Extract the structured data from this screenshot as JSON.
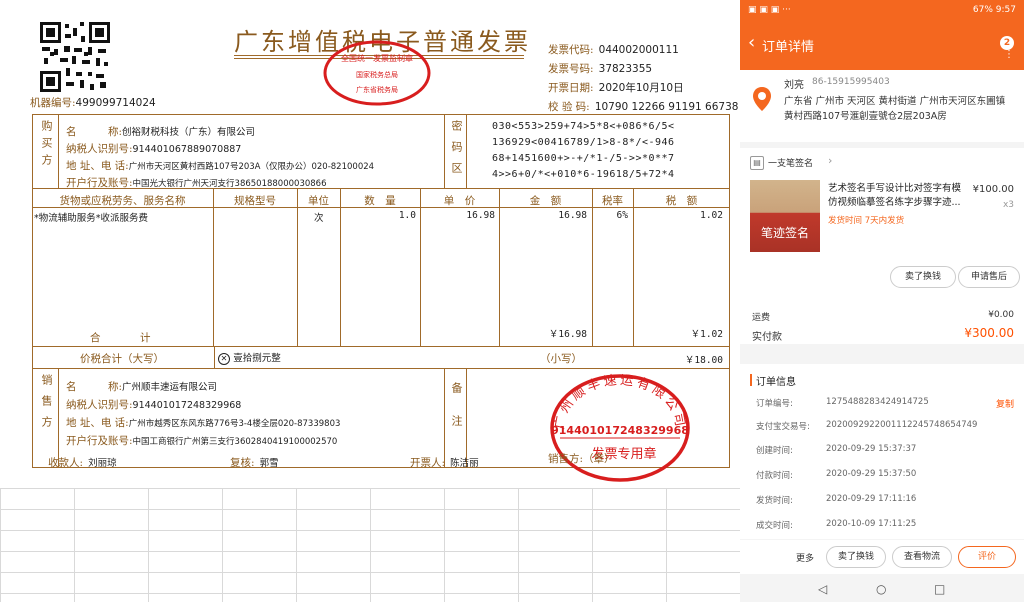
{
  "invoice": {
    "title": "广东增值税电子普通发票",
    "machine_label": "机器编号:",
    "machine_no": "499099714024",
    "header": {
      "code_label": "发票代码:",
      "code": "044002000111",
      "number_label": "发票号码:",
      "number": "37823355",
      "date_label": "开票日期:",
      "date": "2020年10月10日",
      "check_label": "校 验 码:",
      "check": "10790 12266 91191 66738"
    },
    "tax_seal": {
      "line1": "全国统一发票监制章",
      "line2": "国家税务总局",
      "line3": "广东省税务局"
    },
    "buyer": {
      "side_label": "购买方",
      "name_label": "名　　　称:",
      "name": "创裕财税科技（广东）有限公司",
      "taxid_label": "纳税人识别号:",
      "taxid": "914401067889070887",
      "addr_label": "地 址、电 话:",
      "addr": "广州市天河区黄村西路107号203A（仅限办公）020-82100024",
      "bank_label": "开户行及账号:",
      "bank": "中国光大银行广州天河支行38650188000030866"
    },
    "cipher_label": "密码区",
    "cipher_lines": [
      "030<553>259+74>5*8<+086*6/5<",
      "136929<00416789/1>8-8*/<-946",
      "68+1451600+>-+/*1-/5->>*0**7",
      "4>>6+0/*<+010*6-19618/5+72*4"
    ],
    "columns": {
      "item": "货物或应税劳务、服务名称",
      "spec": "规格型号",
      "unit": "单位",
      "qty": "数　量",
      "price": "单　价",
      "amount": "金　额",
      "rate": "税率",
      "tax": "税　额"
    },
    "item": {
      "name": "*物流辅助服务*收派服务费",
      "unit": "次",
      "qty": "1.0",
      "price": "16.98",
      "amount": "16.98",
      "rate": "6%",
      "tax": "1.02"
    },
    "total_label": "合　　　计",
    "total_amount": "￥16.98",
    "total_tax": "￥1.02",
    "grand_label": "价税合计（大写）",
    "grand_words": "壹拾捌元整",
    "small_label": "（小写）",
    "grand_small": "￥18.00",
    "seller": {
      "side_label": "销售方",
      "name_label": "名　　　称:",
      "name": "广州顺丰速运有限公司",
      "taxid_label": "纳税人识别号:",
      "taxid": "914401017248329968",
      "addr_label": "地 址、电 话:",
      "addr": "广州市越秀区东风东路776号3-4楼全层020-87339803",
      "bank_label": "开户行及账号:",
      "bank": "中国工商银行广州第三支行3602840419100002570"
    },
    "remark_label": "备注",
    "seller_seal": {
      "company": "广州顺丰速运有限公司",
      "taxid": "914401017248329968",
      "bottom": "发票专用章"
    },
    "footer": {
      "payee_label": "收款人:",
      "payee": "刘丽琼",
      "reviewer_label": "复核:",
      "reviewer": "郭雪",
      "issuer_label": "开票人:",
      "issuer": "陈洁丽",
      "seller_label": "销售方:（章）"
    }
  },
  "phone": {
    "status": {
      "left": "▣ ▣ ▣ ···",
      "right": "67% 9:57"
    },
    "nav_title": "订单详情",
    "badge": "2",
    "address": {
      "name": "刘亮",
      "phone": "86-15915995403",
      "text": "广东省 广州市 天河区 黄村街道 广州市天河区东圃镇黄村西路107号滙創壹號仓2层203A房"
    },
    "shop": "一支笔签名",
    "product": {
      "title": "艺术签名手写设计比对签字有模仿视频临摹签名练字步骤字迹...",
      "price": "¥100.00",
      "qty": "x3",
      "shipping": "发货时间 7天内发货",
      "thumb_text": "笔迹签名"
    },
    "btn_return": "卖了换钱",
    "btn_aftersale": "申请售后",
    "freight_label": "运费",
    "freight": "¥0.00",
    "paid_label": "实付款",
    "paid": "¥300.00",
    "info_title": "订单信息",
    "order_no_label": "订单编号:",
    "order_no": "1275488283424914725",
    "copy": "复制",
    "alipay_label": "支付宝交易号:",
    "alipay": "2020092922001112245748654749",
    "created_label": "创建时间:",
    "created": "2020-09-29 15:37:37",
    "paytime_label": "付款时间:",
    "paytime": "2020-09-29 15:37:50",
    "shiptime_label": "发货时间:",
    "shiptime": "2020-09-29 17:11:16",
    "donetime_label": "成交时间:",
    "donetime": "2020-10-09 17:11:25",
    "more": "更多",
    "btn_sell": "卖了换钱",
    "btn_logistics": "查看物流",
    "btn_review": "评价",
    "colors": {
      "accent": "#f4671f",
      "price": "#ff5000",
      "invoice_brown": "#8a5a1e",
      "seal_red": "#d81e1e"
    }
  }
}
